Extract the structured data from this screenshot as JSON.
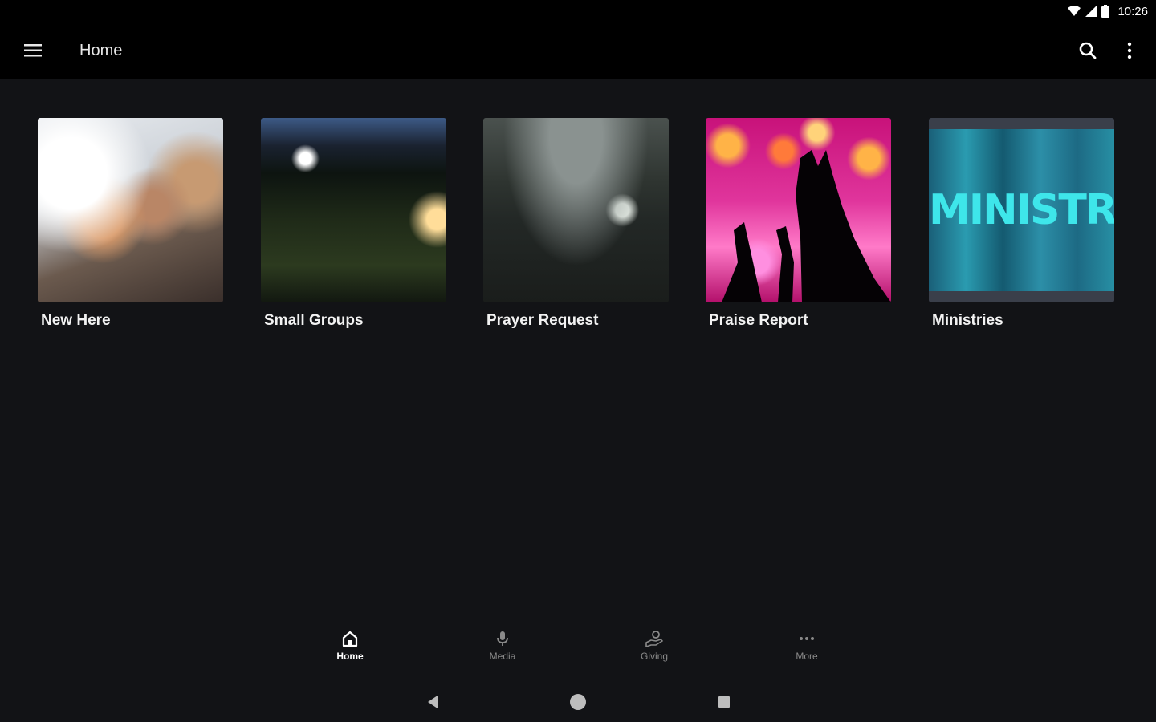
{
  "status_bar": {
    "time": "10:26",
    "icons": [
      "wifi-icon",
      "signal-icon",
      "battery-icon"
    ]
  },
  "app_bar": {
    "title": "Home",
    "icons": [
      "menu-icon",
      "search-icon",
      "more-vert-icon"
    ]
  },
  "tiles": [
    {
      "label": "New Here",
      "image": "people-laughing-photo"
    },
    {
      "label": "Small Groups",
      "image": "campfire-gathering-photo"
    },
    {
      "label": "Prayer Request",
      "image": "worship-crowd-photo"
    },
    {
      "label": "Praise Report",
      "image": "raised-hands-concert-photo"
    },
    {
      "label": "Ministries",
      "image": "ministries-graphic",
      "image_text": "MINISTRIES"
    }
  ],
  "bottom_nav": {
    "items": [
      {
        "label": "Home",
        "icon": "home-icon",
        "active": true
      },
      {
        "label": "Media",
        "icon": "microphone-icon",
        "active": false
      },
      {
        "label": "Giving",
        "icon": "giving-hand-icon",
        "active": false
      },
      {
        "label": "More",
        "icon": "more-horiz-icon",
        "active": false
      }
    ]
  },
  "system_nav": {
    "icons": [
      "back-icon",
      "home-circle-icon",
      "recents-icon"
    ]
  },
  "colors": {
    "background": "#121316",
    "app_bar": "#000000",
    "text": "#ffffff",
    "inactive": "#8a8a8a"
  }
}
